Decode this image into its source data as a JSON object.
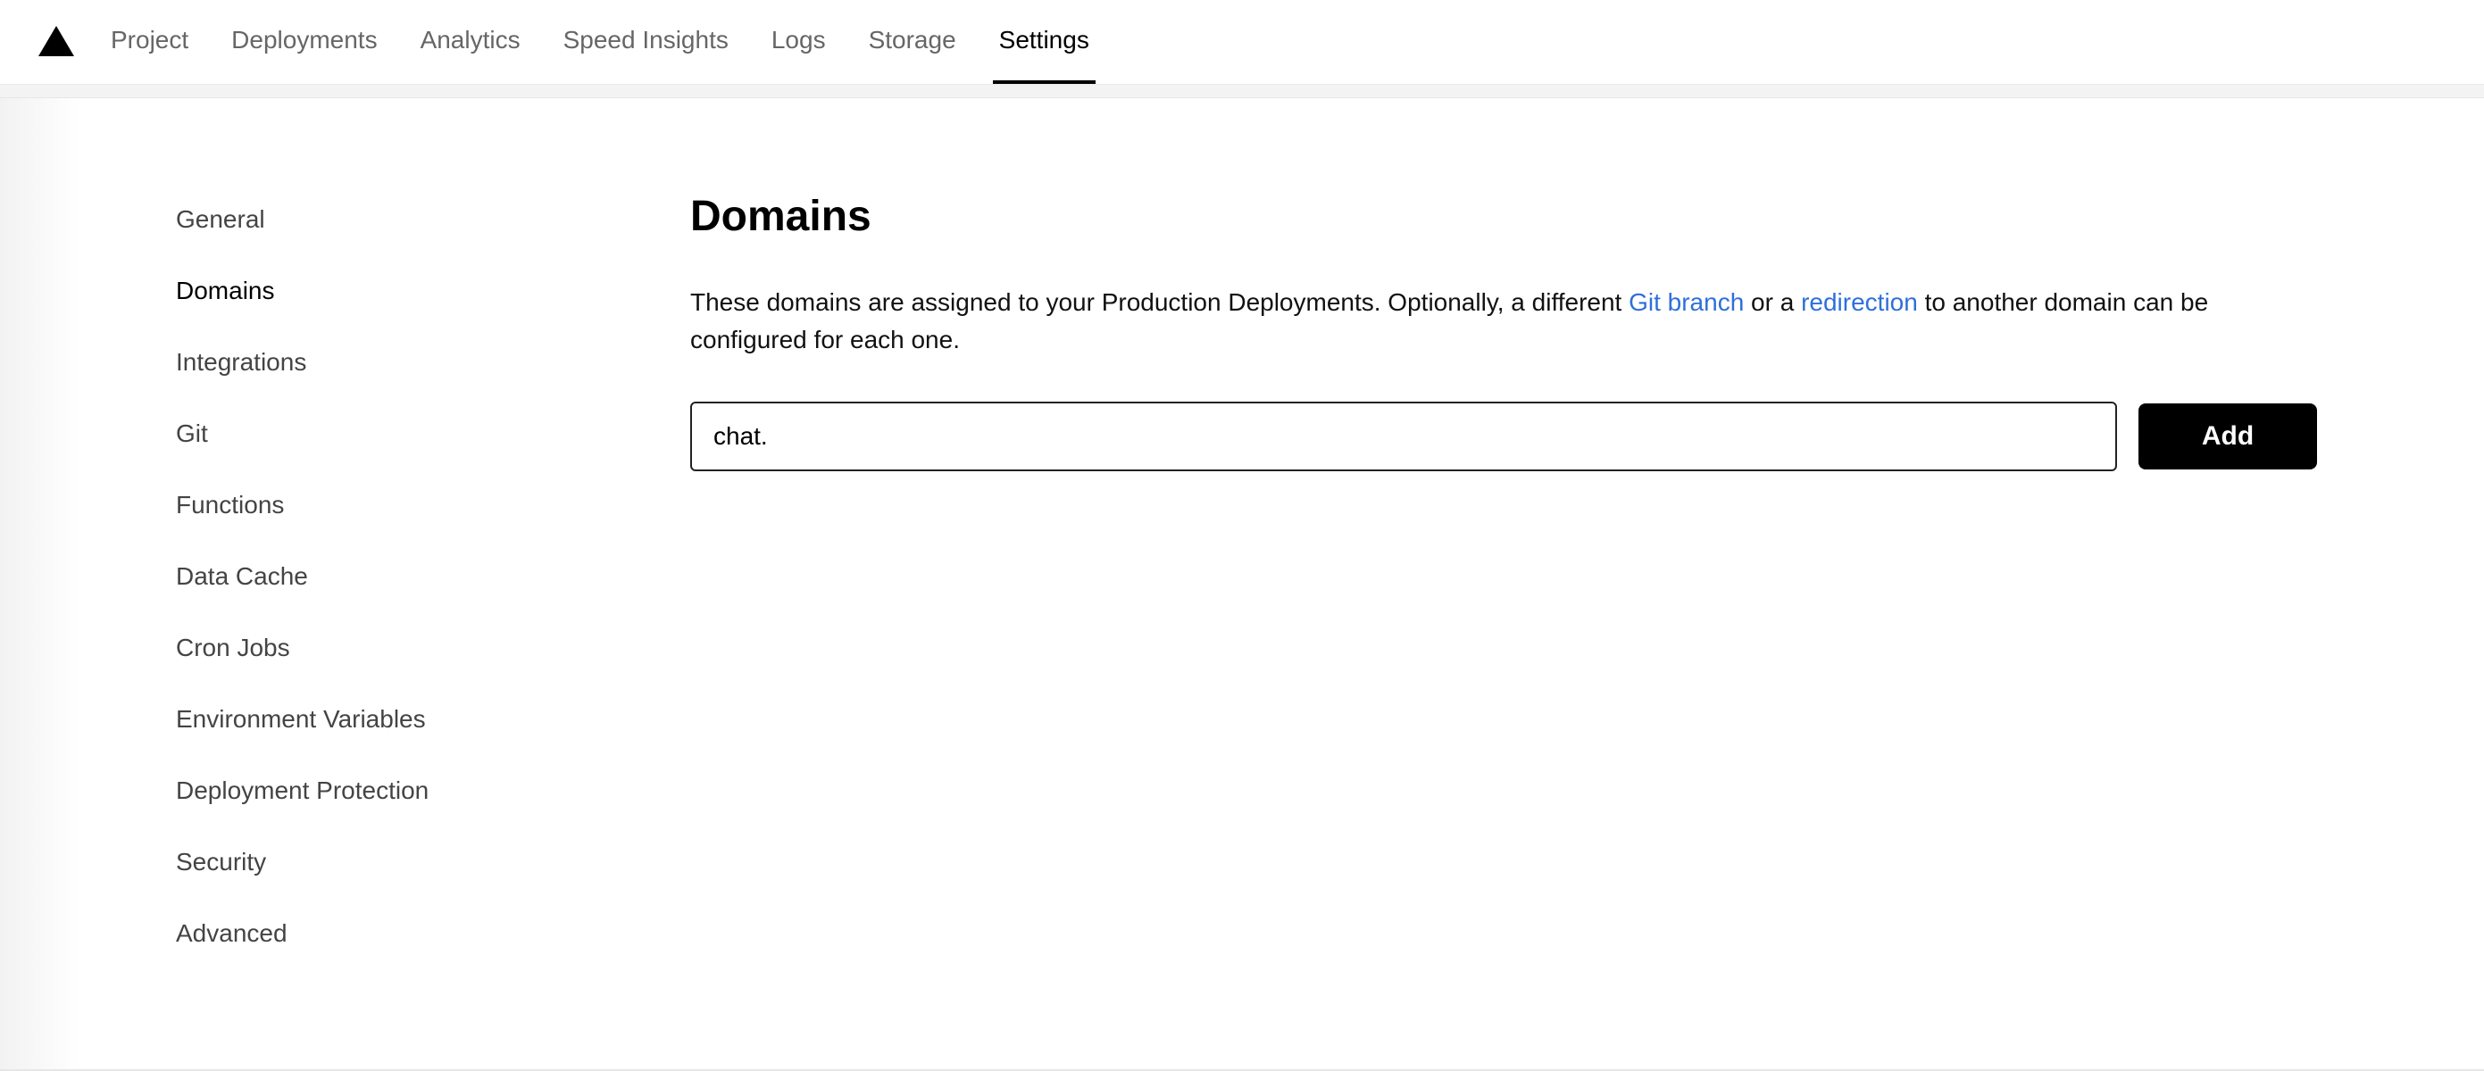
{
  "nav": {
    "logo_icon": "triangle-logo-icon",
    "tabs": [
      {
        "label": "Project"
      },
      {
        "label": "Deployments"
      },
      {
        "label": "Analytics"
      },
      {
        "label": "Speed Insights"
      },
      {
        "label": "Logs"
      },
      {
        "label": "Storage"
      },
      {
        "label": "Settings",
        "active": true
      }
    ]
  },
  "sidebar": {
    "items": [
      {
        "label": "General"
      },
      {
        "label": "Domains",
        "active": true
      },
      {
        "label": "Integrations"
      },
      {
        "label": "Git"
      },
      {
        "label": "Functions"
      },
      {
        "label": "Data Cache"
      },
      {
        "label": "Cron Jobs"
      },
      {
        "label": "Environment Variables"
      },
      {
        "label": "Deployment Protection"
      },
      {
        "label": "Security"
      },
      {
        "label": "Advanced"
      }
    ]
  },
  "main": {
    "title": "Domains",
    "description": {
      "part1": "These domains are assigned to your Production Deployments. Optionally, a different ",
      "link1": "Git branch",
      "part2": " or a ",
      "link2": "redirection",
      "part3": " to another domain can be configured for each one."
    },
    "domain_input_value": "chat.",
    "add_label": "Add"
  },
  "colors": {
    "link": "#2f6fdb",
    "button_bg": "#000000"
  }
}
